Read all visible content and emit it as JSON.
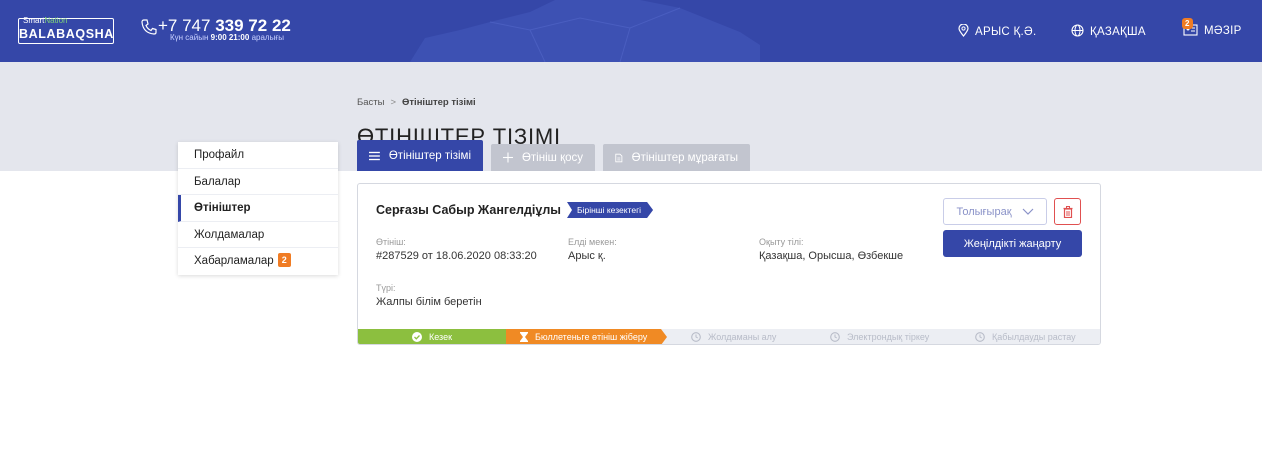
{
  "header": {
    "logo_brand_smart": "Smart",
    "logo_brand_nation": "Nation",
    "logo_name": "BALABAQSHA",
    "phone_prefix": "+7 747",
    "phone_main": "339 72 22",
    "hours_prefix": "Күн сайын",
    "hours_time": "9:00 21:00",
    "hours_suffix": "аралығы",
    "location": "АРЫС Қ.Ә.",
    "language": "ҚАЗАҚША",
    "menu_label": "МӘЗІР",
    "menu_badge": "2"
  },
  "breadcrumb": {
    "home": "Басты",
    "separator": ">",
    "current": "Өтініштер тізімі"
  },
  "page_title": "ӨТІНІШТЕР ТІЗІМІ",
  "tabs": [
    {
      "label": "Өтініштер тізімі",
      "active": true
    },
    {
      "label": "Өтініш қосу",
      "active": false
    },
    {
      "label": "Өтініштер мұрағаты",
      "active": false
    }
  ],
  "sidebar": {
    "items": [
      {
        "label": "Профайл"
      },
      {
        "label": "Балалар"
      },
      {
        "label": "Өтініштер",
        "active": true
      },
      {
        "label": "Жолдамалар"
      },
      {
        "label": "Хабарламалар",
        "badge": "2"
      }
    ]
  },
  "application": {
    "name": "Серғазы Сабыр Жангелдіұлы",
    "queue_badge": "Бірінші кезектегі",
    "number_label": "Өтініш:",
    "number_value": "#287529 от 18.06.2020 08:33:20",
    "locality_label": "Елді мекен:",
    "locality_value": "Арыс қ.",
    "language_label": "Оқыту тілі:",
    "language_value": "Қазақша, Орысша, Өзбекше",
    "type_label": "Түрі:",
    "type_value": "Жалпы білім беретін",
    "details_button": "Толығырақ",
    "renew_button": "Жеңілдікті жаңарту"
  },
  "progress_steps": [
    {
      "label": "Кезек",
      "status": "done"
    },
    {
      "label": "Бюллетеньге өтініш жіберу",
      "status": "current"
    },
    {
      "label": "Жолдаманы алу",
      "status": "pending"
    },
    {
      "label": "Электрондық тіркеу",
      "status": "pending"
    },
    {
      "label": "Қабылдауды растау",
      "status": "pending"
    }
  ],
  "colors": {
    "primary": "#3547a8",
    "accent_orange": "#f08a24",
    "success_green": "#8cbf3f",
    "band_grey": "#e4e6ed",
    "danger_red": "#e05050"
  }
}
